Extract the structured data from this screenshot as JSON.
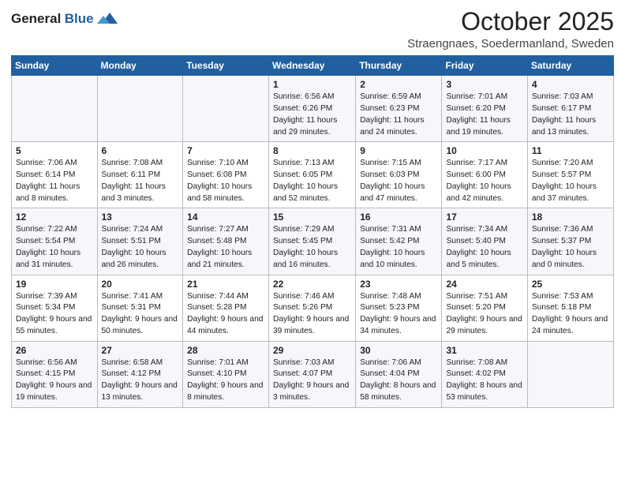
{
  "logo": {
    "general": "General",
    "blue": "Blue"
  },
  "header": {
    "month": "October 2025",
    "location": "Straengnaes, Soedermanland, Sweden"
  },
  "weekdays": [
    "Sunday",
    "Monday",
    "Tuesday",
    "Wednesday",
    "Thursday",
    "Friday",
    "Saturday"
  ],
  "weeks": [
    [
      {
        "day": "",
        "content": ""
      },
      {
        "day": "",
        "content": ""
      },
      {
        "day": "",
        "content": ""
      },
      {
        "day": "1",
        "content": "Sunrise: 6:56 AM\nSunset: 6:26 PM\nDaylight: 11 hours\nand 29 minutes."
      },
      {
        "day": "2",
        "content": "Sunrise: 6:59 AM\nSunset: 6:23 PM\nDaylight: 11 hours\nand 24 minutes."
      },
      {
        "day": "3",
        "content": "Sunrise: 7:01 AM\nSunset: 6:20 PM\nDaylight: 11 hours\nand 19 minutes."
      },
      {
        "day": "4",
        "content": "Sunrise: 7:03 AM\nSunset: 6:17 PM\nDaylight: 11 hours\nand 13 minutes."
      }
    ],
    [
      {
        "day": "5",
        "content": "Sunrise: 7:06 AM\nSunset: 6:14 PM\nDaylight: 11 hours\nand 8 minutes."
      },
      {
        "day": "6",
        "content": "Sunrise: 7:08 AM\nSunset: 6:11 PM\nDaylight: 11 hours\nand 3 minutes."
      },
      {
        "day": "7",
        "content": "Sunrise: 7:10 AM\nSunset: 6:08 PM\nDaylight: 10 hours\nand 58 minutes."
      },
      {
        "day": "8",
        "content": "Sunrise: 7:13 AM\nSunset: 6:05 PM\nDaylight: 10 hours\nand 52 minutes."
      },
      {
        "day": "9",
        "content": "Sunrise: 7:15 AM\nSunset: 6:03 PM\nDaylight: 10 hours\nand 47 minutes."
      },
      {
        "day": "10",
        "content": "Sunrise: 7:17 AM\nSunset: 6:00 PM\nDaylight: 10 hours\nand 42 minutes."
      },
      {
        "day": "11",
        "content": "Sunrise: 7:20 AM\nSunset: 5:57 PM\nDaylight: 10 hours\nand 37 minutes."
      }
    ],
    [
      {
        "day": "12",
        "content": "Sunrise: 7:22 AM\nSunset: 5:54 PM\nDaylight: 10 hours\nand 31 minutes."
      },
      {
        "day": "13",
        "content": "Sunrise: 7:24 AM\nSunset: 5:51 PM\nDaylight: 10 hours\nand 26 minutes."
      },
      {
        "day": "14",
        "content": "Sunrise: 7:27 AM\nSunset: 5:48 PM\nDaylight: 10 hours\nand 21 minutes."
      },
      {
        "day": "15",
        "content": "Sunrise: 7:29 AM\nSunset: 5:45 PM\nDaylight: 10 hours\nand 16 minutes."
      },
      {
        "day": "16",
        "content": "Sunrise: 7:31 AM\nSunset: 5:42 PM\nDaylight: 10 hours\nand 10 minutes."
      },
      {
        "day": "17",
        "content": "Sunrise: 7:34 AM\nSunset: 5:40 PM\nDaylight: 10 hours\nand 5 minutes."
      },
      {
        "day": "18",
        "content": "Sunrise: 7:36 AM\nSunset: 5:37 PM\nDaylight: 10 hours\nand 0 minutes."
      }
    ],
    [
      {
        "day": "19",
        "content": "Sunrise: 7:39 AM\nSunset: 5:34 PM\nDaylight: 9 hours\nand 55 minutes."
      },
      {
        "day": "20",
        "content": "Sunrise: 7:41 AM\nSunset: 5:31 PM\nDaylight: 9 hours\nand 50 minutes."
      },
      {
        "day": "21",
        "content": "Sunrise: 7:44 AM\nSunset: 5:28 PM\nDaylight: 9 hours\nand 44 minutes."
      },
      {
        "day": "22",
        "content": "Sunrise: 7:46 AM\nSunset: 5:26 PM\nDaylight: 9 hours\nand 39 minutes."
      },
      {
        "day": "23",
        "content": "Sunrise: 7:48 AM\nSunset: 5:23 PM\nDaylight: 9 hours\nand 34 minutes."
      },
      {
        "day": "24",
        "content": "Sunrise: 7:51 AM\nSunset: 5:20 PM\nDaylight: 9 hours\nand 29 minutes."
      },
      {
        "day": "25",
        "content": "Sunrise: 7:53 AM\nSunset: 5:18 PM\nDaylight: 9 hours\nand 24 minutes."
      }
    ],
    [
      {
        "day": "26",
        "content": "Sunrise: 6:56 AM\nSunset: 4:15 PM\nDaylight: 9 hours\nand 19 minutes."
      },
      {
        "day": "27",
        "content": "Sunrise: 6:58 AM\nSunset: 4:12 PM\nDaylight: 9 hours\nand 13 minutes."
      },
      {
        "day": "28",
        "content": "Sunrise: 7:01 AM\nSunset: 4:10 PM\nDaylight: 9 hours\nand 8 minutes."
      },
      {
        "day": "29",
        "content": "Sunrise: 7:03 AM\nSunset: 4:07 PM\nDaylight: 9 hours\nand 3 minutes."
      },
      {
        "day": "30",
        "content": "Sunrise: 7:06 AM\nSunset: 4:04 PM\nDaylight: 8 hours\nand 58 minutes."
      },
      {
        "day": "31",
        "content": "Sunrise: 7:08 AM\nSunset: 4:02 PM\nDaylight: 8 hours\nand 53 minutes."
      },
      {
        "day": "",
        "content": ""
      }
    ]
  ]
}
